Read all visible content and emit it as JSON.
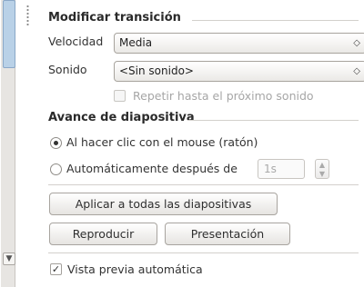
{
  "transition": {
    "title": "Modificar transición",
    "speed_label": "Velocidad",
    "speed_value": "Media",
    "sound_label": "Sonido",
    "sound_value": "<Sin sonido>",
    "repeat_label": "Repetir hasta el próximo sonido",
    "repeat_checked": false
  },
  "advance": {
    "title": "Avance de diapositiva",
    "on_click_label": "Al hacer clic con el mouse (ratón)",
    "automatic_label": "Automáticamente después de",
    "automatic_value": "1s"
  },
  "buttons": {
    "apply_all": "Aplicar a todas las diapositivas",
    "play": "Reproducir",
    "slideshow": "Presentación"
  },
  "preview": {
    "label": "Vista previa automática",
    "checked": true
  },
  "icons": {
    "combo_arrows": "up-down-arrows-icon",
    "check": "checkmark-icon",
    "scroll_down": "chevron-down-icon"
  },
  "colors": {
    "scroll_thumb": "#b9d1e7",
    "panel_bg": "#ffffff"
  }
}
